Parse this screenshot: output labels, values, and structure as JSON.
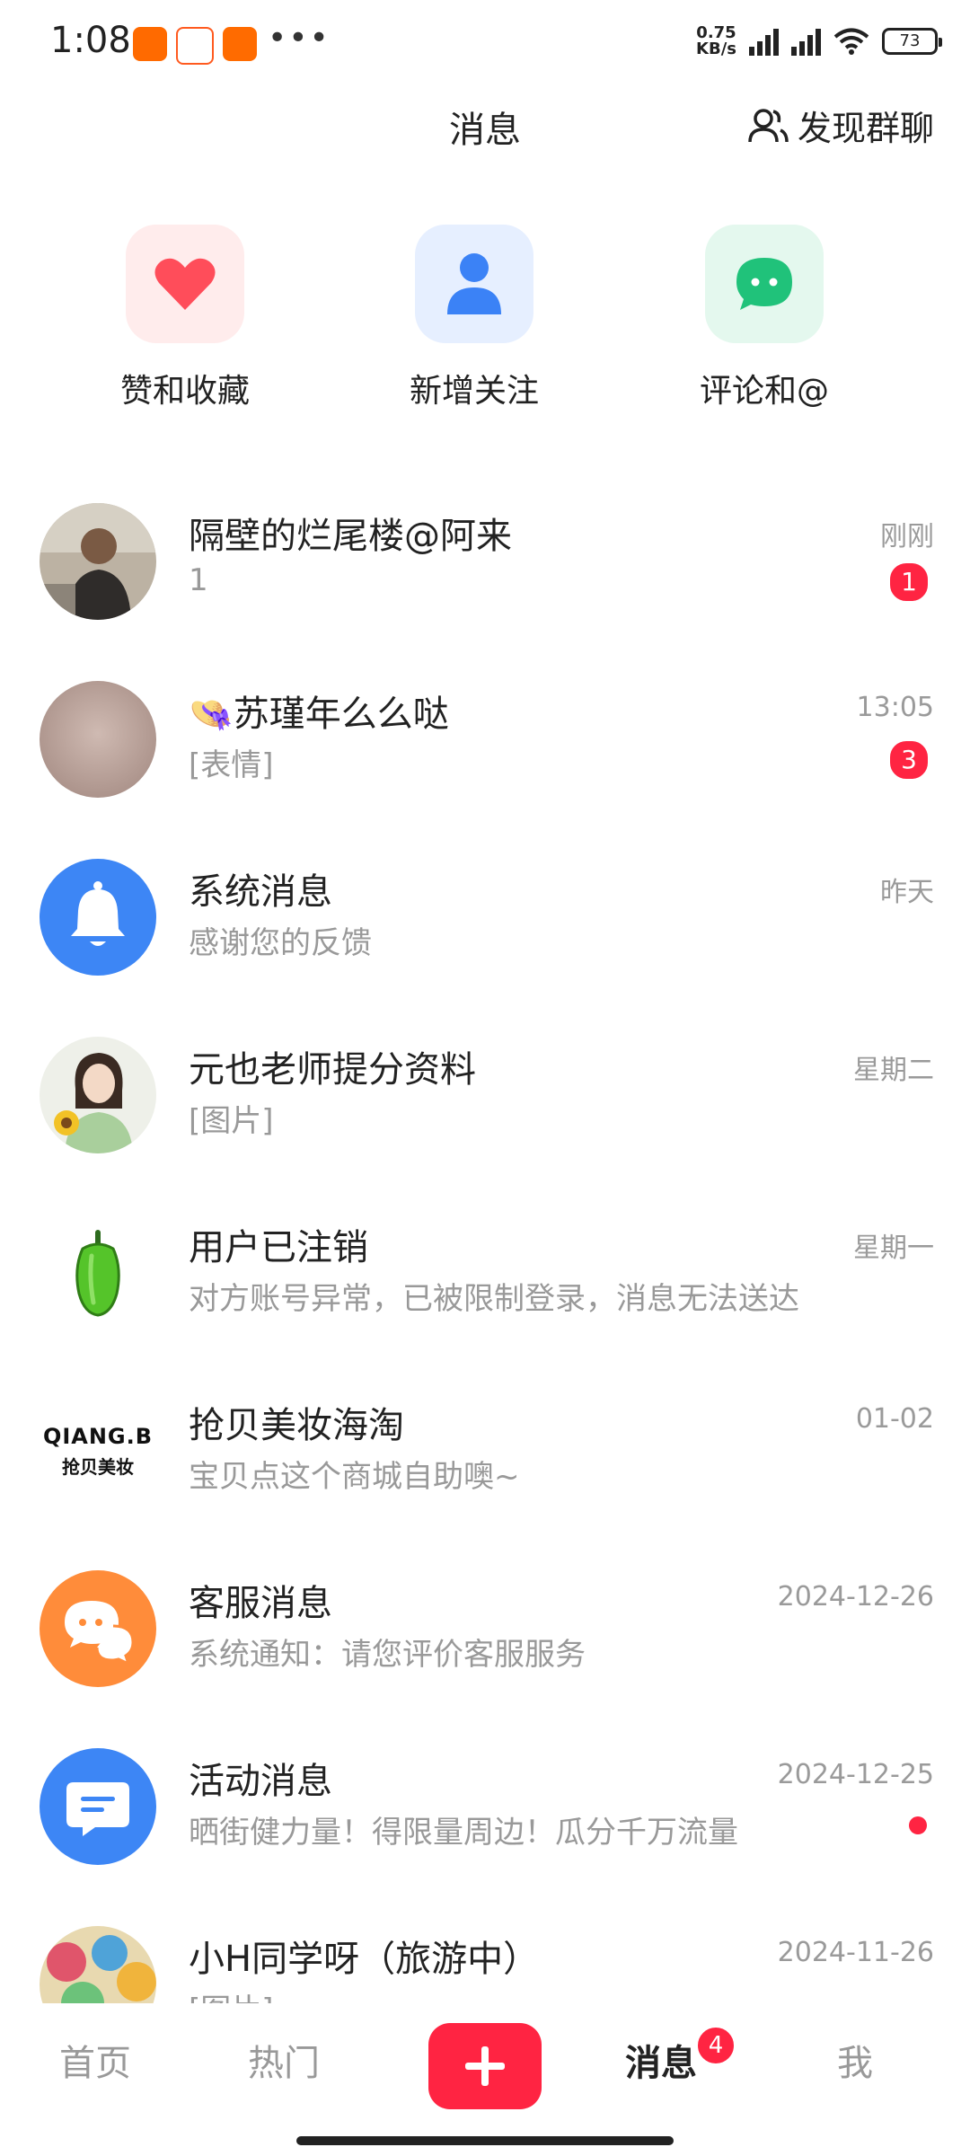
{
  "status_bar": {
    "time": "1:08",
    "network_speed_value": "0.75",
    "network_speed_unit": "KB/s",
    "battery": "73"
  },
  "header": {
    "title": "消息",
    "discover_label": "发现群聊"
  },
  "shortcuts": [
    {
      "label": "赞和收藏",
      "icon": "heart-icon",
      "color": "#ff4d5a"
    },
    {
      "label": "新增关注",
      "icon": "person-icon",
      "color": "#3b82f6"
    },
    {
      "label": "评论和@",
      "icon": "chat-bubble-icon",
      "color": "#20c27a"
    }
  ],
  "messages": [
    {
      "title": "隔壁的烂尾楼@阿来",
      "subtitle": "1",
      "time": "刚刚",
      "badge": "1",
      "avatar": "photo-avatar"
    },
    {
      "title": "👒苏瑾年么么哒",
      "subtitle": "[表情]",
      "time": "13:05",
      "badge": "3",
      "avatar": "photo-avatar"
    },
    {
      "title": "系统消息",
      "subtitle": "感谢您的反馈",
      "time": "昨天",
      "avatar": "bell-icon"
    },
    {
      "title": "元也老师提分资料",
      "subtitle": "[图片]",
      "time": "星期二",
      "avatar": "photo-avatar"
    },
    {
      "title": "用户已注销",
      "subtitle": "对方账号异常，已被限制登录，消息无法送达",
      "time": "星期一",
      "avatar": "pepper-icon"
    },
    {
      "title": "抢贝美妆海淘",
      "subtitle": "宝贝点这个商城自助噢~",
      "time": "01-02",
      "avatar_text_1": "QIANG.B",
      "avatar_text_2": "抢贝美妆"
    },
    {
      "title": "客服消息",
      "subtitle": "系统通知：请您评价客服服务",
      "time": "2024-12-26",
      "avatar": "chat-bubbles-icon"
    },
    {
      "title": "活动消息",
      "subtitle": "晒街健力量！得限量周边！瓜分千万流量",
      "time": "2024-12-25",
      "unread_dot": true,
      "avatar": "message-icon"
    },
    {
      "title": "小H同学呀（旅游中）",
      "subtitle": "[图片]",
      "time": "2024-11-26",
      "avatar": "photo-avatar"
    }
  ],
  "bottom_nav": {
    "home": "首页",
    "hot": "热门",
    "messages": "消息",
    "messages_badge": "4",
    "me": "我"
  },
  "colors": {
    "accent": "#ff2442",
    "muted_text": "#999999"
  }
}
